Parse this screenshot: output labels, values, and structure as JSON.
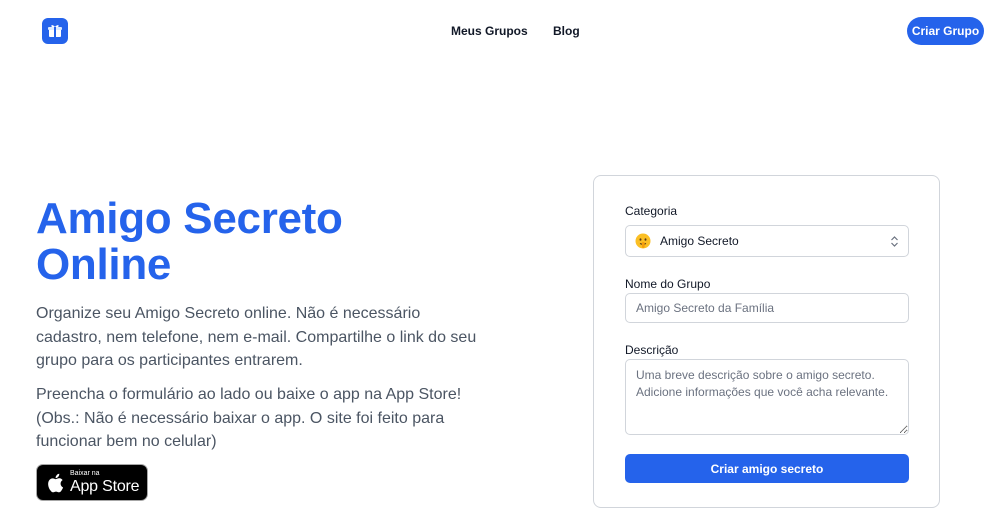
{
  "header": {
    "logo_icon": "gift-box-icon",
    "nav": [
      {
        "label": "Meus Grupos"
      },
      {
        "label": "Blog"
      }
    ],
    "cta_label": "Criar Grupo"
  },
  "hero": {
    "title": "Amigo Secreto Online",
    "paragraph1": "Organize seu Amigo Secreto online. Não é necessário cadastro, nem telefone, nem e-mail. Compartilhe o link do seu grupo para os participantes entrarem.",
    "paragraph2": "Preencha o formulário ao lado ou baixe o app na App Store! (Obs.: Não é necessário baixar o app. O site foi feito para funcionar bem no celular)",
    "appstore": {
      "small": "Baixar na",
      "big": "App Store"
    }
  },
  "form": {
    "category_label": "Categoria",
    "category_value": "Amigo Secreto",
    "category_icon": "shushing-face-icon",
    "group_name_label": "Nome do Grupo",
    "group_name_placeholder": "Amigo Secreto da Família",
    "description_label": "Descrição",
    "description_placeholder": "Uma breve descrição sobre o amigo secreto. Adicione informações que você acha relevante.",
    "submit_label": "Criar amigo secreto"
  },
  "colors": {
    "accent": "#2563eb",
    "body_text": "#4b5563",
    "border": "#d1d5db"
  }
}
